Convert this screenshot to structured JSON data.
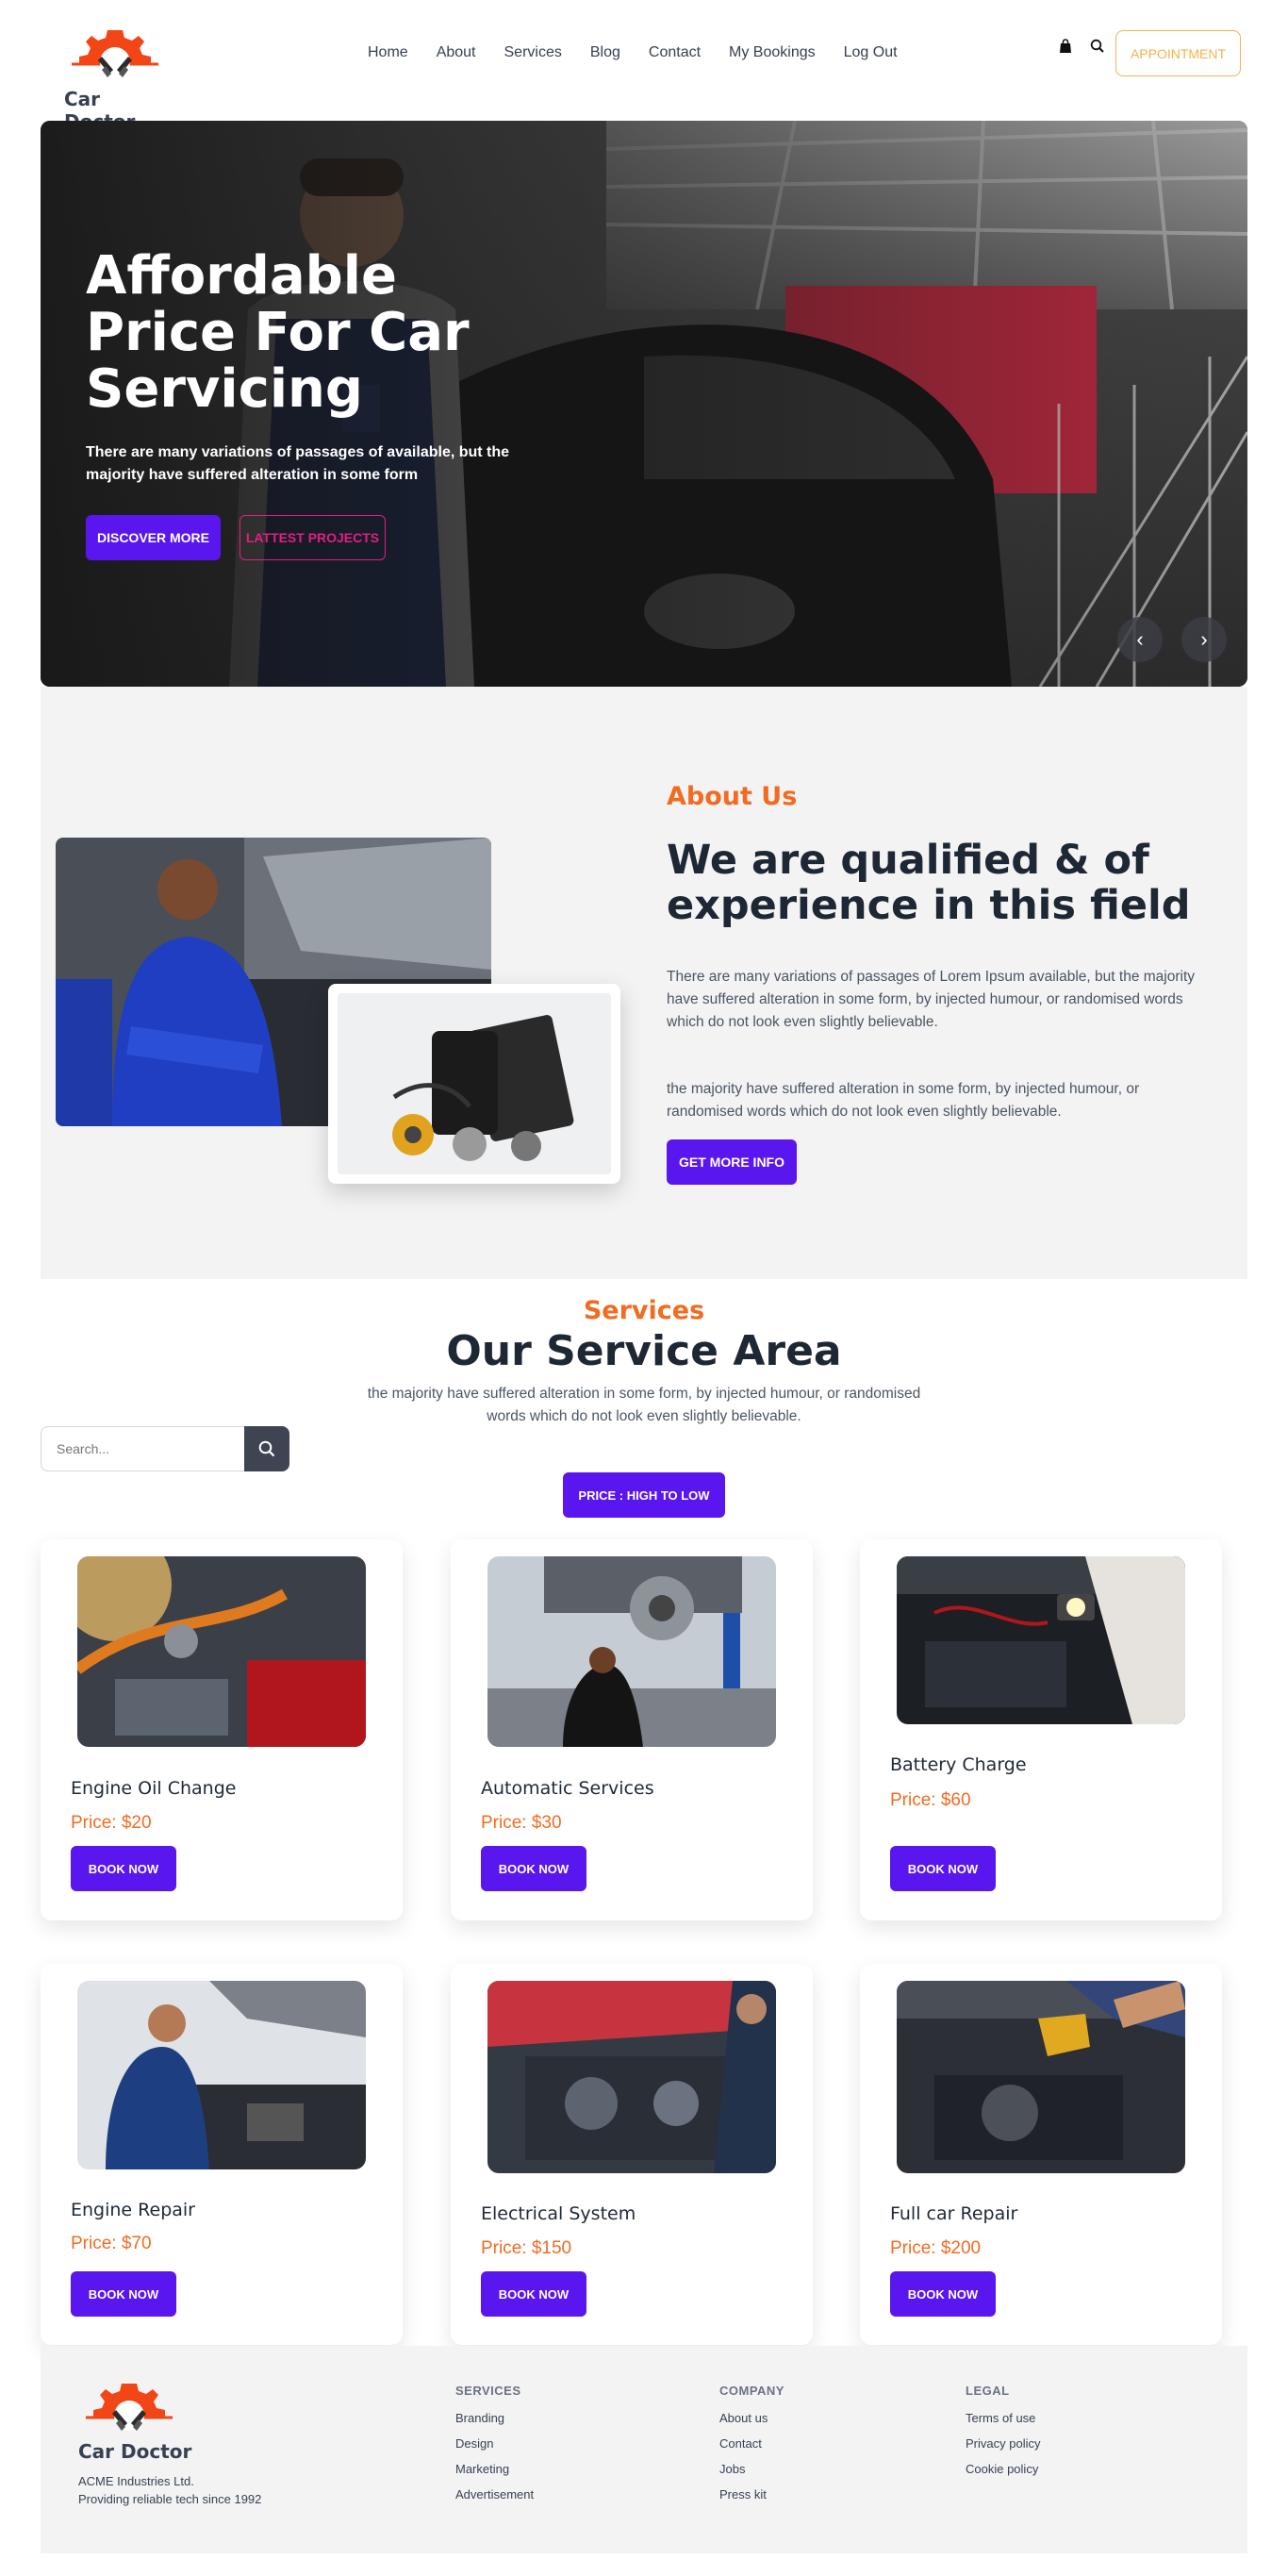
{
  "brand": {
    "name": "Car Doctor"
  },
  "nav": {
    "items": [
      "Home",
      "About",
      "Services",
      "Blog",
      "Contact",
      "My Bookings",
      "Log Out"
    ],
    "icons": [
      "bag-icon",
      "search-icon"
    ],
    "appointment_label": "APPOINTMENT"
  },
  "hero": {
    "title": "Affordable Price For Car Servicing",
    "description": "There are many variations of passages of available, but the majority have suffered alteration in some form",
    "primary_button": "DISCOVER MORE",
    "secondary_button": "LATTEST PROJECTS",
    "prev_arrow": "‹",
    "next_arrow": "›"
  },
  "about": {
    "kicker": "About Us",
    "title": "We are qualified & of experience in this field",
    "paragraph1": "There are many variations of passages of Lorem Ipsum available, but the majority have suffered alteration in some form, by injected humour, or randomised words which do not look even slightly believable.",
    "paragraph2": "the majority have suffered alteration in some form, by injected humour, or randomised words which do not look even slightly believable.",
    "button": "GET MORE INFO"
  },
  "services": {
    "kicker": "Services",
    "title": "Our Service Area",
    "description": "the majority have suffered alteration in some form, by injected humour, or randomised words which do not look even slightly believable.",
    "search_placeholder": "Search...",
    "sort_label": "PRICE : HIGH TO LOW",
    "book_label": "BOOK NOW",
    "items": [
      {
        "name": "Engine Oil Change",
        "price": "Price: $20"
      },
      {
        "name": "Automatic Services",
        "price": "Price: $30"
      },
      {
        "name": "Battery Charge",
        "price": "Price: $60"
      },
      {
        "name": "Engine Repair",
        "price": "Price: $70"
      },
      {
        "name": "Electrical System",
        "price": "Price: $150"
      },
      {
        "name": "Full car Repair",
        "price": "Price: $200"
      }
    ]
  },
  "footer": {
    "brand": "Car Doctor",
    "company_line": "ACME Industries Ltd.",
    "tagline": "Providing reliable tech since 1992",
    "columns": [
      {
        "title": "SERVICES",
        "links": [
          "Branding",
          "Design",
          "Marketing",
          "Advertisement"
        ]
      },
      {
        "title": "COMPANY",
        "links": [
          "About us",
          "Contact",
          "Jobs",
          "Press kit"
        ]
      },
      {
        "title": "LEGAL",
        "links": [
          "Terms of use",
          "Privacy policy",
          "Cookie policy"
        ]
      }
    ]
  },
  "colors": {
    "primary": "#5a16ee",
    "accent_orange": "#f26b21",
    "appointment": "#f4b24a",
    "secondary_pink": "#e01f82"
  }
}
